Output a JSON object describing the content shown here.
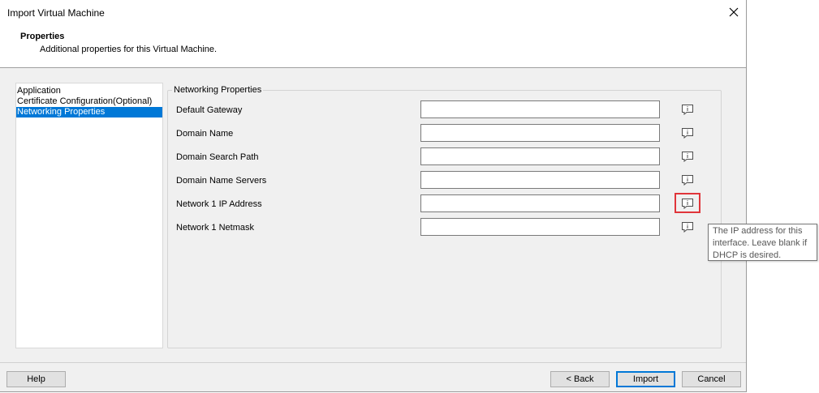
{
  "window": {
    "title": "Import Virtual Machine"
  },
  "header": {
    "title": "Properties",
    "subtitle": "Additional properties for this Virtual Machine."
  },
  "nav": {
    "items": [
      {
        "label": "Application"
      },
      {
        "label": "Certificate Configuration(Optional)"
      },
      {
        "label": "Networking Properties",
        "selected": true
      }
    ]
  },
  "group": {
    "legend": "Networking Properties",
    "fields": [
      {
        "label": "Default Gateway",
        "value": ""
      },
      {
        "label": "Domain Name",
        "value": ""
      },
      {
        "label": "Domain Search Path",
        "value": ""
      },
      {
        "label": "Domain Name Servers",
        "value": ""
      },
      {
        "label": "Network 1 IP Address",
        "value": ""
      },
      {
        "label": "Network 1 Netmask",
        "value": ""
      }
    ],
    "info_icon": "info-comment-icon"
  },
  "tooltip": {
    "lines": [
      "The IP address for this",
      "interface. Leave blank if",
      "DHCP is desired."
    ]
  },
  "buttons": {
    "help": "Help",
    "back": "< Back",
    "import": "Import",
    "cancel": "Cancel"
  },
  "colors": {
    "selection": "#0078d7",
    "highlight": "#e0353a"
  }
}
